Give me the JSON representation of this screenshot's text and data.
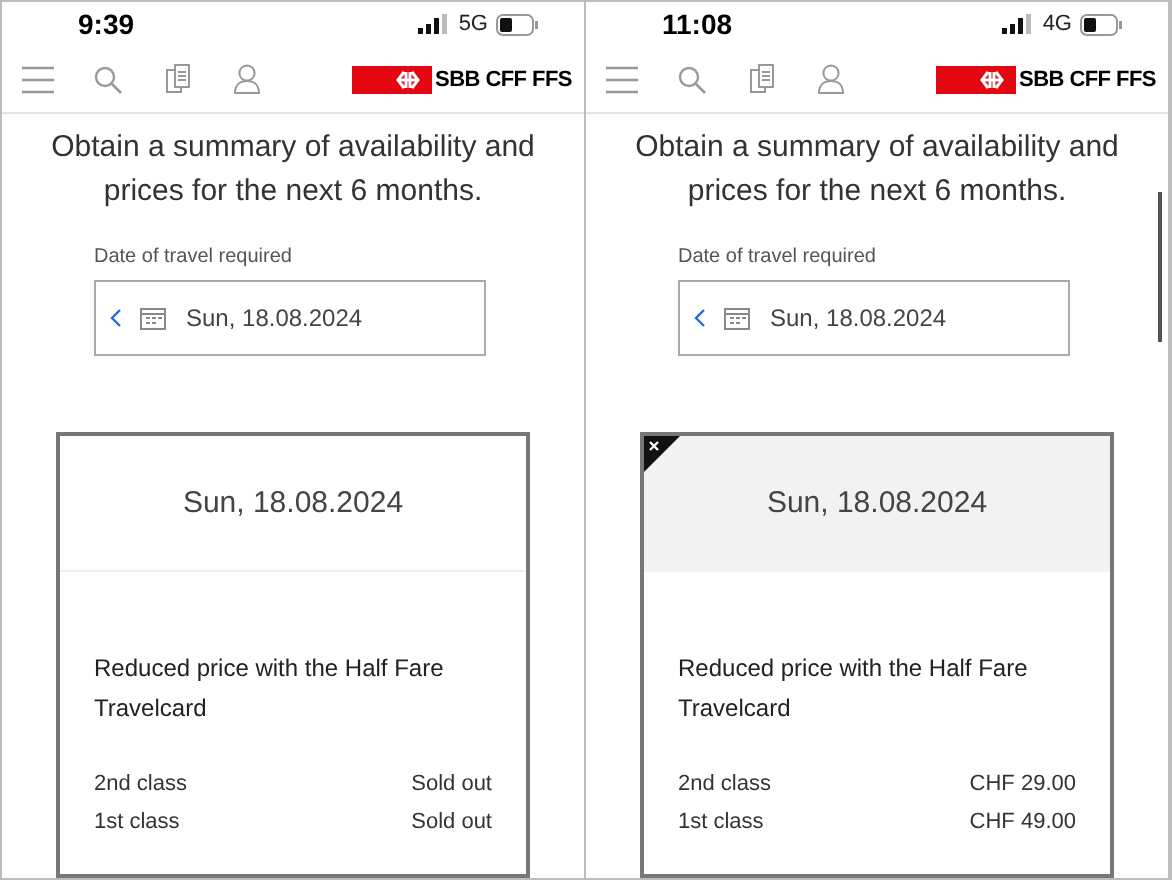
{
  "screens": [
    {
      "status_bar": {
        "time": "9:39",
        "network": "5G"
      },
      "logo": "SBB CFF FFS",
      "intro": "Obtain a summary of availability and prices for the next 6 months.",
      "date_field": {
        "label": "Date of travel required",
        "value": "Sun, 18.08.2024"
      },
      "card": {
        "date": "Sun, 18.08.2024",
        "highlighted": false,
        "title": "Reduced price with the Half Fare Travelcard",
        "rows": [
          {
            "class": "2nd class",
            "price": "Sold out"
          },
          {
            "class": "1st class",
            "price": "Sold out"
          }
        ]
      },
      "scrollbar": false
    },
    {
      "status_bar": {
        "time": "11:08",
        "network": "4G"
      },
      "logo": "SBB CFF FFS",
      "intro": "Obtain a summary of availability and prices for the next 6 months.",
      "date_field": {
        "label": "Date of travel required",
        "value": "Sun, 18.08.2024"
      },
      "card": {
        "date": "Sun, 18.08.2024",
        "highlighted": true,
        "title": "Reduced price with the Half Fare Travelcard",
        "rows": [
          {
            "class": "2nd class",
            "price": "CHF 29.00"
          },
          {
            "class": "1st class",
            "price": "CHF 49.00"
          }
        ]
      },
      "scrollbar": true
    }
  ]
}
